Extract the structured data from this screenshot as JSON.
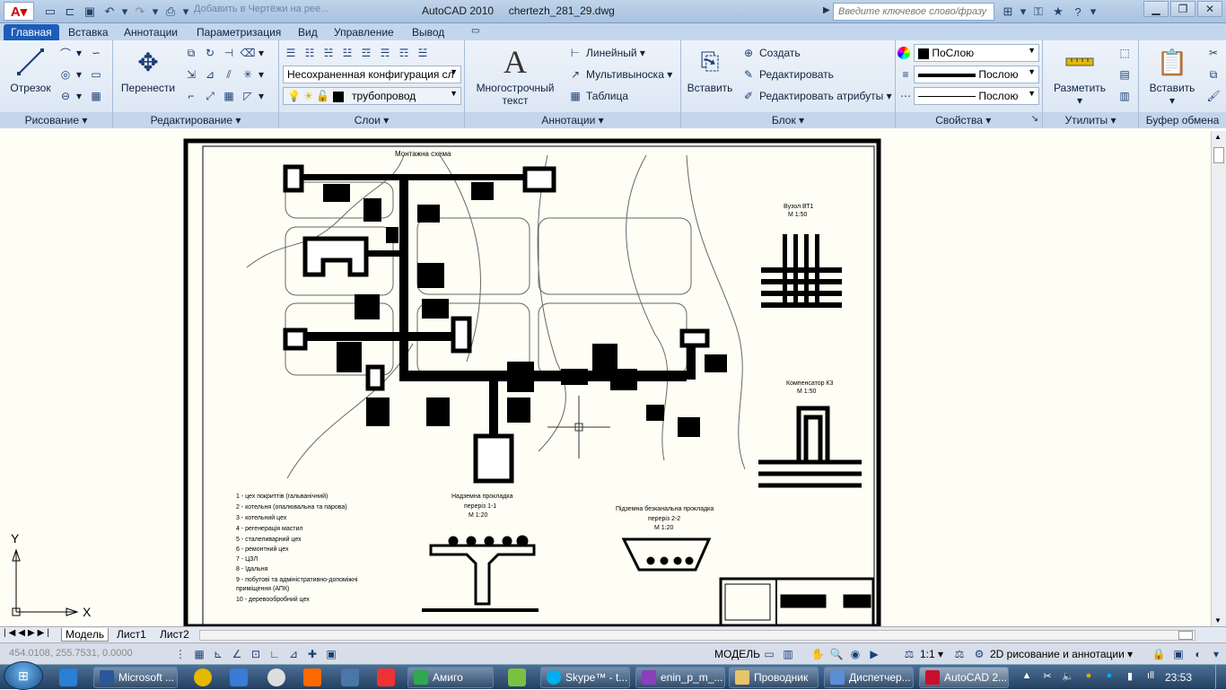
{
  "titlebar": {
    "app_title": "AutoCAD 2010",
    "file_name": "chertezh_281_29.dwg",
    "search_placeholder": "Введите ключевое слово/фразу",
    "background_tab": "Добавить в Чертёжи на рее..."
  },
  "tabs": [
    "Главная",
    "Вставка",
    "Аннотации",
    "Параметризация",
    "Вид",
    "Управление",
    "Вывод"
  ],
  "panels": {
    "draw": {
      "title": "Рисование",
      "line_label": "Отрезок"
    },
    "modify": {
      "title": "Редактирование",
      "move_label": "Перенести"
    },
    "layers": {
      "title": "Слои",
      "layer_state": "Несохраненная конфигурация сл",
      "current_layer": "трубопровод"
    },
    "annotations": {
      "title": "Аннотации",
      "mtext_label": "Многострочный текст",
      "linear": "Линейный",
      "multileader": "Мультивыноска",
      "table": "Таблица"
    },
    "block": {
      "title": "Блок",
      "insert_label": "Вставить",
      "create": "Создать",
      "edit": "Редактировать",
      "edit_attr": "Редактировать атрибуты"
    },
    "properties": {
      "title": "Свойства",
      "color": "ПоСлою",
      "lineweight": "Послою",
      "linetype": "Послою"
    },
    "utilities": {
      "title": "Утилиты",
      "measure_label": "Разметить"
    },
    "clipboard": {
      "title": "Буфер обмена",
      "paste_label": "Вставить"
    }
  },
  "drawing": {
    "title": "Монтажна схема",
    "node_title": "Вузол ВТ1",
    "node_scale": "М 1:50",
    "comp_title": "Компенсатор К3",
    "comp_scale": "М 1:50",
    "section1_title": "Надземна прокладка",
    "section1_sub": "переріз 1-1",
    "section1_scale": "М 1:20",
    "section2_title": "Підземна безканальна прокладка",
    "section2_sub": "переріз 2-2",
    "section2_scale": "М 1:20",
    "legend": [
      "1 - цех покриттів (гальванічний)",
      "2 - котельня (опалювальна та парова)",
      "3 - котельний цех",
      "4 - регенерація мастил",
      "5 - сталеливарний цех",
      "6 - ремонтний цех",
      "7 - ЦЗЛ",
      "8 - їдальня",
      "9 - побутові та адміністративно-допоміжні",
      "приміщення (АПК)",
      "10 - деревообробний цех"
    ],
    "axis_y": "Y",
    "axis_x": "X"
  },
  "layout_tabs": [
    "Модель",
    "Лист1",
    "Лист2"
  ],
  "status": {
    "coords": "454.0108, 255.7531, 0.0000",
    "model": "МОДЕЛЬ",
    "scale": "1:1",
    "workspace": "2D рисование и аннотации"
  },
  "taskbar": {
    "items": [
      "Microsoft ...",
      "Амиго",
      "Skype™ - t...",
      "enin_p_m_...",
      "Проводник",
      "Диспетчер...",
      "AutoCAD 2..."
    ],
    "clock": "23:53"
  },
  "colors": {
    "accent": "#1c5db8",
    "drawing_bg": "#fffef5",
    "taskbar": "#23405f"
  }
}
